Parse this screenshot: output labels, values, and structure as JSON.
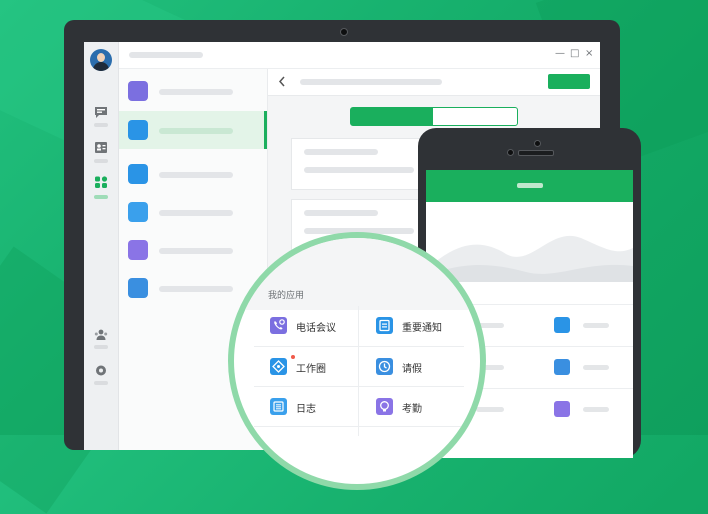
{
  "section_title": "我的应用",
  "apps": [
    {
      "id": "phone-conference",
      "label": "电话会议",
      "icon": "phone-icon",
      "color": "#7b6fe0",
      "has_badge": false
    },
    {
      "id": "important-notice",
      "label": "重要通知",
      "icon": "document-icon",
      "color": "#2a94e6",
      "has_badge": false
    },
    {
      "id": "work-circle",
      "label": "工作圈",
      "icon": "compass-icon",
      "color": "#2a94e6",
      "has_badge": true
    },
    {
      "id": "leave",
      "label": "请假",
      "icon": "clock-icon",
      "color": "#3a8fe0",
      "has_badge": false
    },
    {
      "id": "log",
      "label": "日志",
      "icon": "list-icon",
      "color": "#3aa0ec",
      "has_badge": false
    },
    {
      "id": "attendance",
      "label": "考勤",
      "icon": "lightbulb-icon",
      "color": "#8a74e6",
      "has_badge": false
    }
  ],
  "desktop": {
    "rail_icons": [
      "chat-icon",
      "contacts-icon",
      "apps-icon",
      "team-icon",
      "settings-icon"
    ],
    "list_icons": [
      "phone-icon",
      "document-icon",
      "compass-icon",
      "list-icon",
      "lightbulb-icon",
      "clock-icon"
    ],
    "active_list_index": 1,
    "window_controls": [
      "—",
      "□",
      "×"
    ]
  },
  "colors": {
    "brand_green": "#1aaf5d",
    "lens_ring": "#8fd9a9",
    "background": "#18b26f"
  }
}
